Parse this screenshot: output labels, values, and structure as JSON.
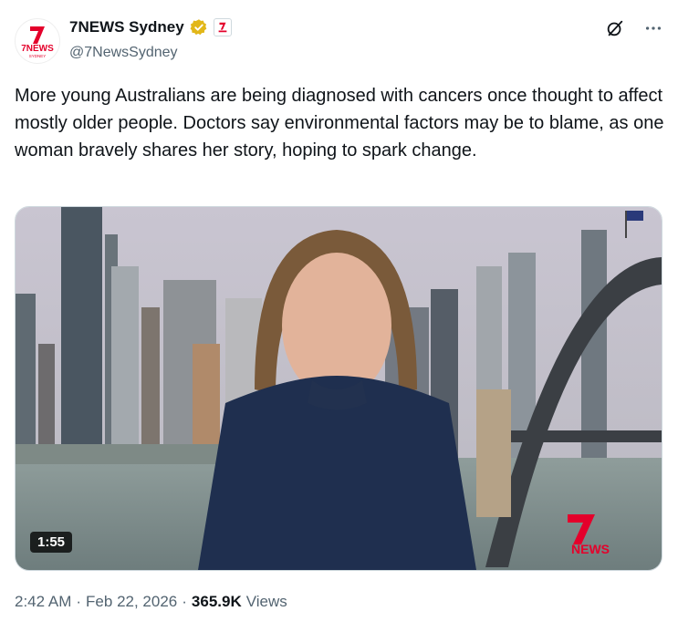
{
  "author": {
    "display_name": "7NEWS Sydney",
    "handle": "@7NewsSydney",
    "avatar_logo_text": "7NEWS",
    "avatar_sub_text": "SYDNEY"
  },
  "icons": {
    "verified": "gold-verified-badge-icon",
    "affiliate": "seven-network-affiliate-icon",
    "grok": "grok-icon",
    "more": "more-icon"
  },
  "tweet": {
    "text": "More young Australians are being diagnosed with cancers once thought to affect mostly older people. Doctors say environmental factors may be to blame, as one woman bravely shares her story, hoping to spark change."
  },
  "media": {
    "duration": "1:55",
    "watermark": "NEWS"
  },
  "footer": {
    "time": "2:42 AM",
    "separator": "·",
    "date": "Feb 22, 2026",
    "views_count": "365.9K",
    "views_label": "Views"
  },
  "colors": {
    "brand_red": "#e4002b",
    "verified_gold": "#e2b719",
    "text_primary": "#0f1419",
    "text_secondary": "#536471"
  }
}
